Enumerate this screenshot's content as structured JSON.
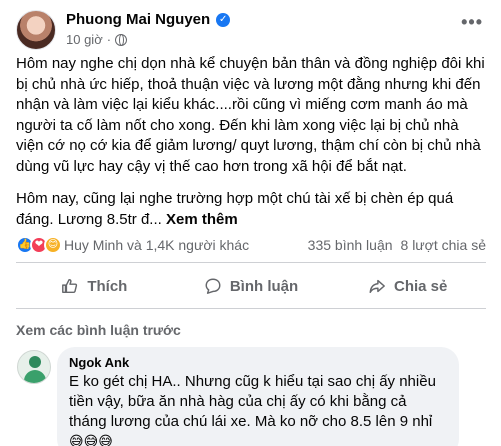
{
  "post": {
    "author": "Phuong Mai Nguyen",
    "verified_glyph": "✓",
    "time": "10 giờ",
    "separator": "·",
    "more_glyph": "•••",
    "paragraph1": "Hôm nay nghe chị dọn nhà kể chuyện bản thân và đồng nghiệp đôi khi bị chủ nhà ức hiếp, thoả thuận việc và lương một đằng nhưng khi đến nhận và làm việc lại kiểu khác....rồi cũng vì miếng cơm manh áo mà người ta cố làm nốt cho xong. Đến khi làm xong việc lại bị chủ nhà viện cớ nọ cớ kia để giảm lương/ quyt lương, thậm chí còn bị chủ nhà dùng vũ lực hay cậy vị thế cao hơn trong xã hội để bắt nạt.",
    "paragraph2": "Hôm nay, cũng lại nghe trường hợp một chú tài xế bị chèn ép quá đáng. Lương 8.5tr đ...",
    "see_more": "Xem thêm"
  },
  "stats": {
    "reactors": "Huy Minh và 1,4K người khác",
    "comments": "335 bình luận",
    "shares": "8 lượt chia sẻ",
    "reaction_glyphs": [
      "👍",
      "❤",
      "😊"
    ]
  },
  "actions": {
    "like": "Thích",
    "comment": "Bình luận",
    "share": "Chia sẻ"
  },
  "comments": {
    "view_previous": "Xem các bình luận trước",
    "items": [
      {
        "name": "Ngok Ank",
        "text": "E ko gét chị HA.. Nhưng cũg k hiểu tại sao chị ấy nhiều tiền vậy, bữa ăn nhà hàg của chị ấy có khi bằng cả tháng lương của chú lái xe. Mà ko nỡ cho 8.5 lên 9 nhỉ",
        "emojis": "😅😅😅"
      }
    ]
  },
  "colors": {
    "primary_text": "#050505",
    "secondary_text": "#65676b",
    "facebook_blue": "#1877f2",
    "comment_bg": "#f0f2f5",
    "divider": "#ced0d4"
  }
}
